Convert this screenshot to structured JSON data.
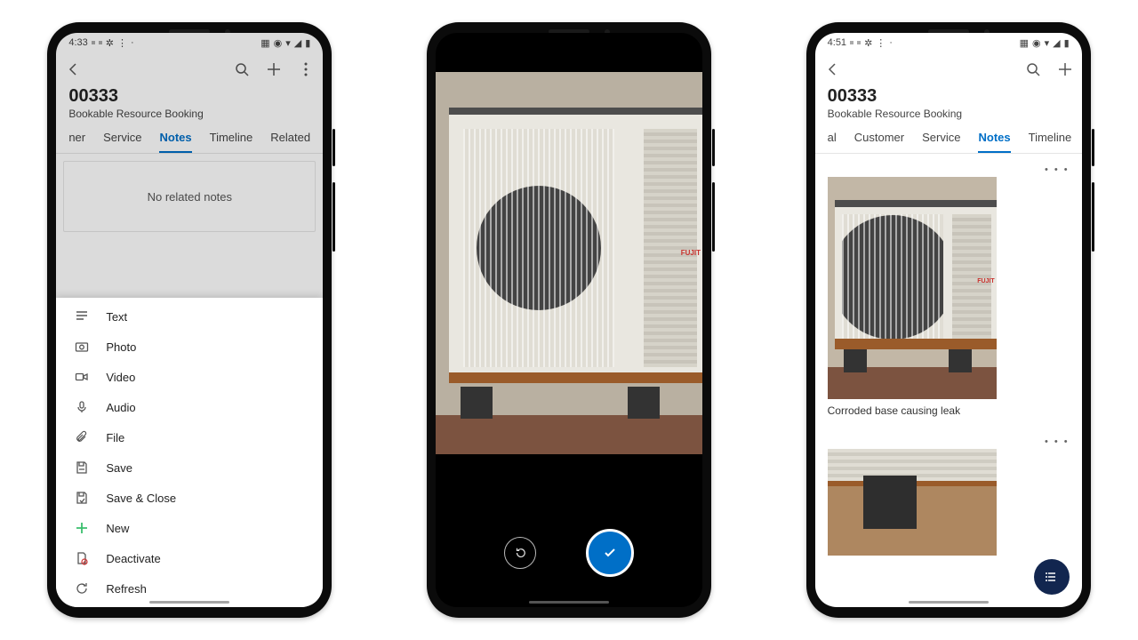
{
  "phone1": {
    "status": {
      "time": "4:33",
      "leftIcons": "sq sq gear dots",
      "rightIcons": "cap eye wifi sig bat"
    },
    "titleId": "00333",
    "subtitle": "Bookable Resource Booking",
    "tabs": [
      {
        "label": "ner",
        "active": false
      },
      {
        "label": "Service",
        "active": false
      },
      {
        "label": "Notes",
        "active": true
      },
      {
        "label": "Timeline",
        "active": false
      },
      {
        "label": "Related",
        "active": false
      }
    ],
    "emptyText": "No related notes",
    "menu": [
      {
        "label": "Text",
        "icon": "text"
      },
      {
        "label": "Photo",
        "icon": "photo"
      },
      {
        "label": "Video",
        "icon": "video"
      },
      {
        "label": "Audio",
        "icon": "audio"
      },
      {
        "label": "File",
        "icon": "file"
      },
      {
        "label": "Save",
        "icon": "save"
      },
      {
        "label": "Save & Close",
        "icon": "saveclose"
      },
      {
        "label": "New",
        "icon": "new"
      },
      {
        "label": "Deactivate",
        "icon": "deactivate"
      },
      {
        "label": "Refresh",
        "icon": "refresh"
      }
    ]
  },
  "phone2": {
    "brand": "FUJIT"
  },
  "phone3": {
    "status": {
      "time": "4:51"
    },
    "titleId": "00333",
    "subtitle": "Bookable Resource Booking",
    "tabs": [
      {
        "label": "al",
        "active": false
      },
      {
        "label": "Customer",
        "active": false
      },
      {
        "label": "Service",
        "active": false
      },
      {
        "label": "Notes",
        "active": true
      },
      {
        "label": "Timeline",
        "active": false
      }
    ],
    "note1Caption": "Corroded base causing leak",
    "moreDots": "• • •"
  }
}
